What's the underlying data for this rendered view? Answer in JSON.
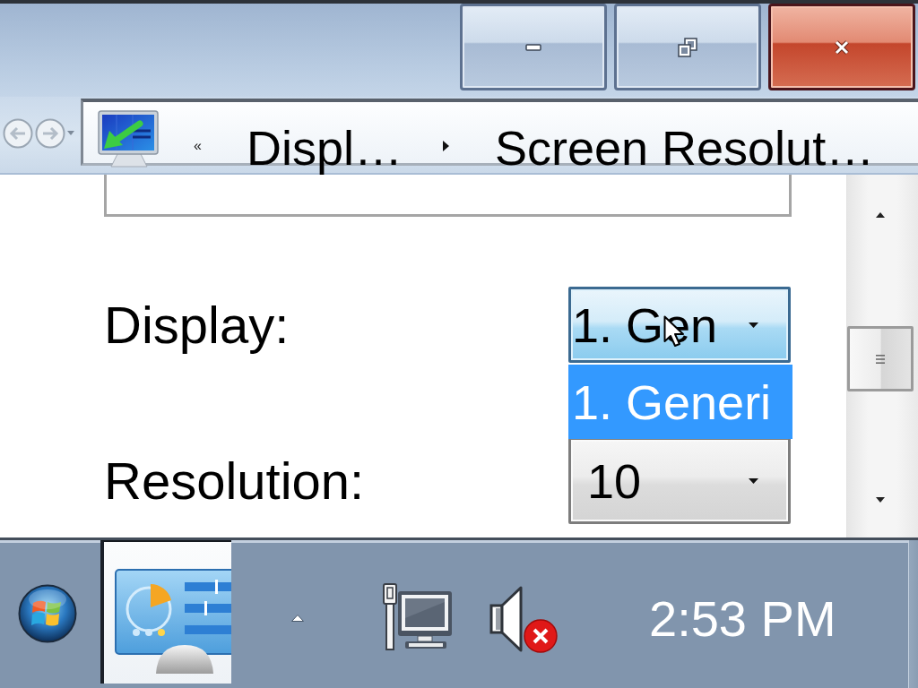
{
  "window": {
    "caption_buttons": [
      {
        "kind": "minimize"
      },
      {
        "kind": "restore"
      },
      {
        "kind": "close"
      }
    ]
  },
  "address_bar": {
    "navigation": [
      {
        "kind": "back",
        "disabled": true
      },
      {
        "kind": "forward",
        "disabled": true
      }
    ],
    "overflow": "«",
    "breadcrumb": [
      "Displ…",
      "Screen Resolut…"
    ]
  },
  "settings": {
    "fields": [
      {
        "label": "Display:",
        "value": "1. Gen",
        "expanded": true,
        "options": [
          {
            "label": "1. Generi",
            "selected": true
          }
        ]
      },
      {
        "label": "Resolution:",
        "value": "10",
        "expanded": false
      }
    ]
  },
  "taskbar": {
    "tasks": [
      {
        "active": true
      }
    ],
    "tray_icons": [
      {
        "kind": "network"
      },
      {
        "kind": "volume",
        "muted": true
      }
    ],
    "clock": "2:53 PM"
  }
}
